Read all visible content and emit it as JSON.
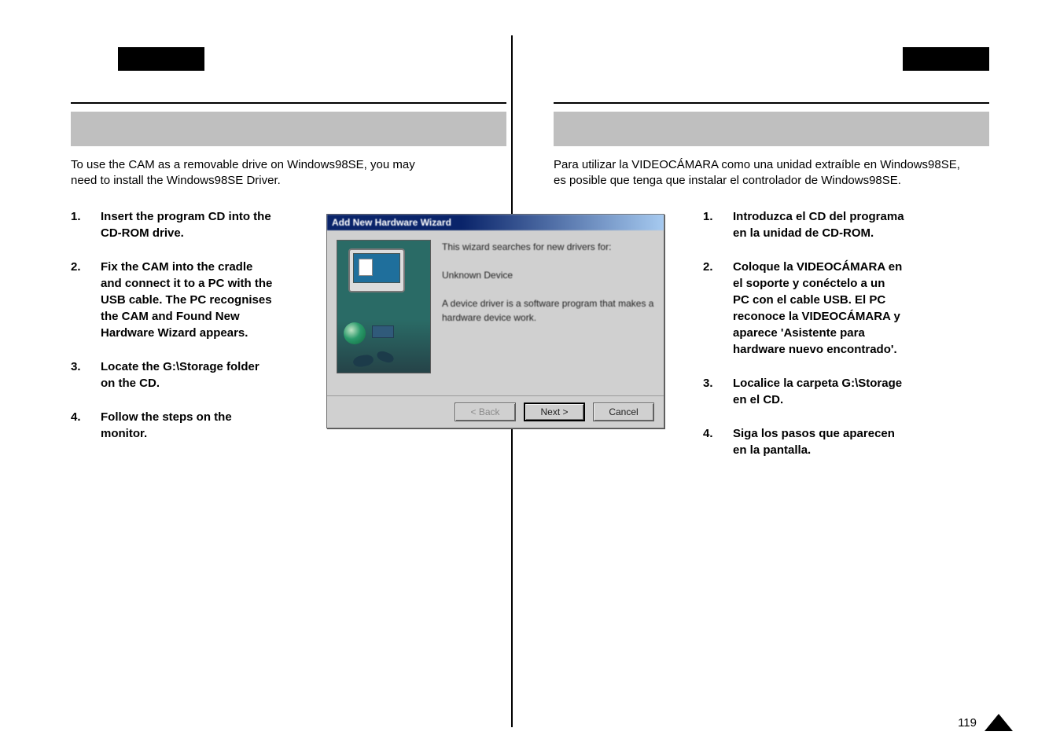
{
  "left": {
    "intro": "To use the CAM as a removable drive on Windows98SE, you may\nneed to install the Windows98SE Driver.",
    "steps": [
      {
        "num": "1.",
        "text": "Insert the program CD into the\nCD-ROM drive."
      },
      {
        "num": "2.",
        "text": "Fix the CAM into the cradle\nand connect it to a PC with the\nUSB cable. The PC recognises\nthe CAM and  Found New\nHardware Wizard  appears."
      },
      {
        "num": "3.",
        "text": "Locate the G:\\Storage folder\non the CD."
      },
      {
        "num": "4.",
        "text": "Follow the steps on the\nmonitor."
      }
    ]
  },
  "right": {
    "intro": "Para utilizar la VIDEOCÁMARA como una unidad extraíble en Windows98SE,\nes posible que tenga que instalar el controlador de Windows98SE.",
    "steps": [
      {
        "num": "1.",
        "text": "Introduzca el CD del programa\nen la unidad de CD-ROM."
      },
      {
        "num": "2.",
        "text": "Coloque la VIDEOCÁMARA en\nel soporte y conéctelo a un\nPC con el cable USB. El PC\nreconoce la VIDEOCÁMARA y\naparece 'Asistente para\nhardware nuevo encontrado'."
      },
      {
        "num": "3.",
        "text": "Localice la carpeta G:\\Storage\nen el CD."
      },
      {
        "num": "4.",
        "text": "Siga los pasos que aparecen\nen la pantalla."
      }
    ]
  },
  "wizard": {
    "title": "Add New Hardware Wizard",
    "line1": "This wizard searches for new drivers for:",
    "line2": "Unknown Device",
    "line3": "A device driver is a software program that makes a hardware device work.",
    "buttons": {
      "back": "< Back",
      "next": "Next >",
      "cancel": "Cancel"
    }
  },
  "page_number": "119"
}
